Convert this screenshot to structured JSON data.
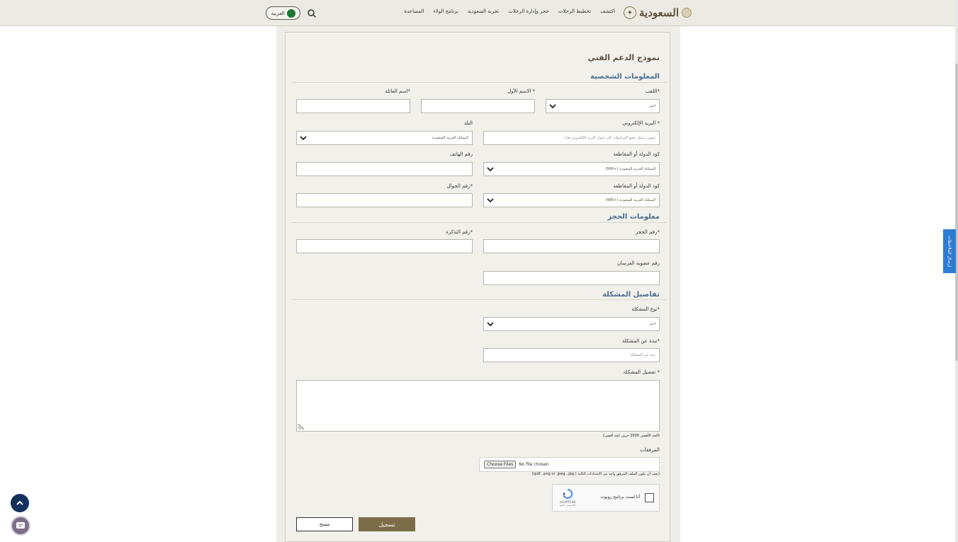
{
  "header": {
    "logo_text": "السعودية",
    "nav": [
      "اكتشف",
      "تخطيط الرحلات",
      "حجز وإدارة الرحلات",
      "تجربة السعودية",
      "برنامج الولاء",
      "المساعدة"
    ],
    "language": "العربية"
  },
  "form": {
    "title": "نموذج الدعم الفني",
    "sections": {
      "personal": "المعلومات الشخصية",
      "booking": "معلومات الحجز",
      "issue": "تفاصيل المشكلة"
    },
    "title_label": "*اللقب",
    "title_value": "اختر",
    "first_name_label": "* الاسم الأول",
    "last_name_label": "*اسم العائلة",
    "email_label": "* البريد الإلكتروني",
    "email_placeholder": "سوف نرسل جميع المراسلات إلى عنوان البريد الإلكتروني هذا...",
    "country_label": "البلد",
    "country_value": "المملكة العربية السعودية",
    "code_label_1": "كود الدولة أو المقاطعة",
    "code_value_1": "المملكة العربية السعودية (+966)",
    "phone_label": "رقم الهاتف",
    "code_label_2": "كود الدولة أو المقاطعة",
    "code_value_2": "المملكة العربية السعودية (+966)",
    "mobile_label": "*رقم الجوال",
    "booking_label": "*رقم الحجز",
    "ticket_label": "*رقم التذكرة",
    "membership_label": "رقم عضوية الفرسان",
    "issue_type_label": "*نوع المشكلة",
    "issue_type_value": "اختر",
    "issue_summary_label": "*نبذة عن المشكلة",
    "issue_summary_placeholder": "نبذة عن المشكلة",
    "issue_details_label": "* تفصيل المشكلة",
    "char_note": "(الحد الأقصى 2000 حرف كحد أقصى)",
    "attachments_label": "المرفقات",
    "choose_files": "Choose Files",
    "no_file": "No file chosen",
    "file_note": "(يجب أن يكون الملف المرفق واحد من الامتدادات التالية (.pdf ,.png or .jpeg ,.jpg))",
    "captcha_text": "أنا لست برنامج روبوت",
    "captcha_brand": "reCAPTCHA",
    "captcha_terms": "الخصوصية - البنود",
    "submit_label": "تسجيل",
    "clear_label": "مسح"
  },
  "feedback_tab": "إرسال الملاحظات",
  "colors": {
    "brand": "#7b6d47",
    "section_title": "#4e6d90",
    "feedback": "#2e7bd4"
  }
}
